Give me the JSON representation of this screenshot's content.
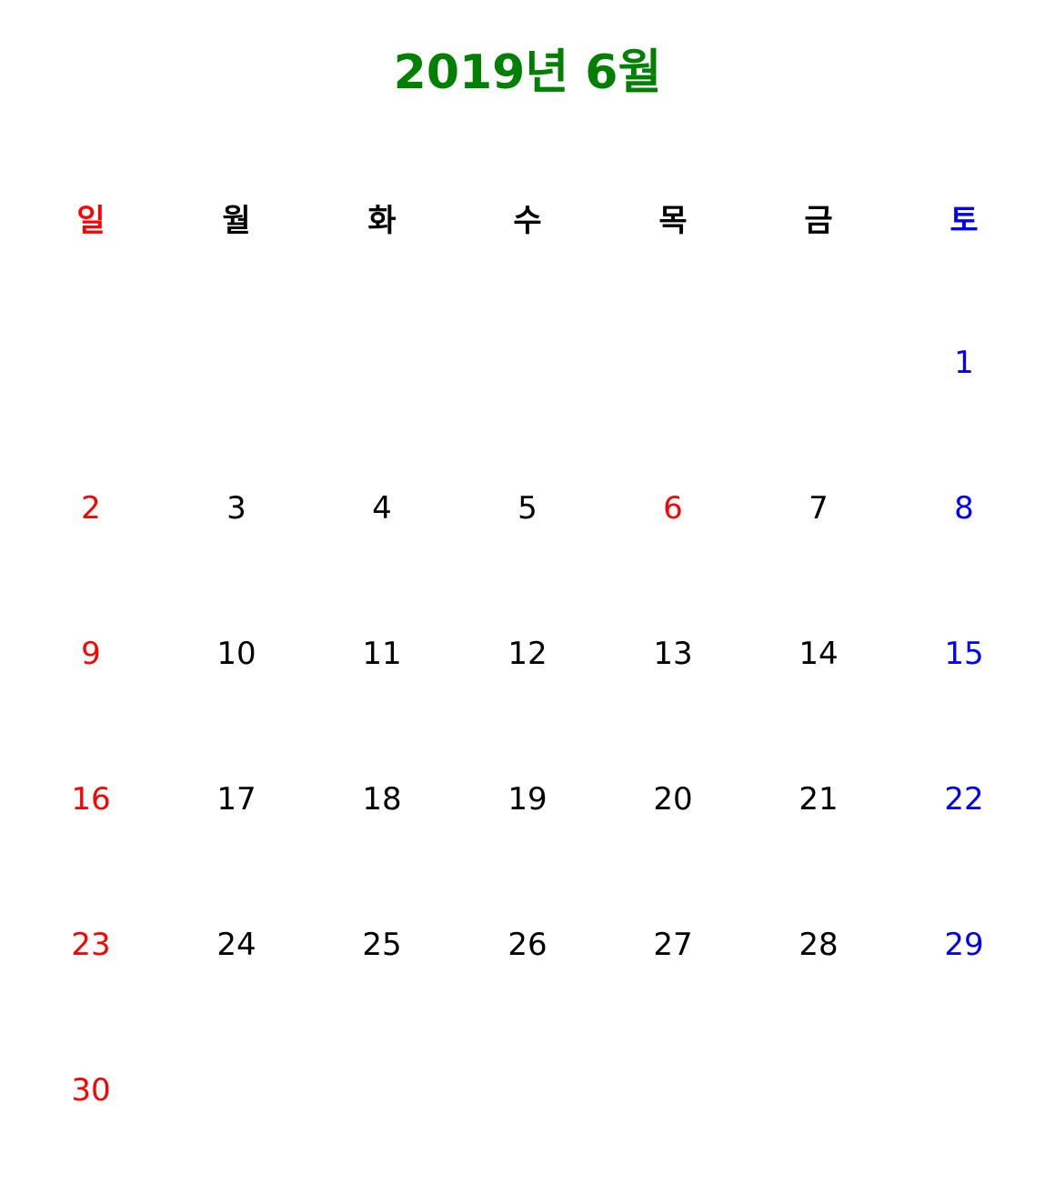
{
  "title": "2019년 6월",
  "colors": {
    "title": "#008000",
    "sunday": "#ff0000",
    "saturday": "#0000ff",
    "holiday": "#ff0000",
    "weekday": "#000000"
  },
  "weekdays": [
    "일",
    "월",
    "화",
    "수",
    "목",
    "금",
    "토"
  ],
  "weeks": [
    [
      "",
      "",
      "",
      "",
      "",
      "",
      "1"
    ],
    [
      "2",
      "3",
      "4",
      "5",
      "6",
      "7",
      "8"
    ],
    [
      "9",
      "10",
      "11",
      "12",
      "13",
      "14",
      "15"
    ],
    [
      "16",
      "17",
      "18",
      "19",
      "20",
      "21",
      "22"
    ],
    [
      "23",
      "24",
      "25",
      "26",
      "27",
      "28",
      "29"
    ],
    [
      "30",
      "",
      "",
      "",
      "",
      "",
      ""
    ]
  ],
  "holidays": [
    "6"
  ]
}
